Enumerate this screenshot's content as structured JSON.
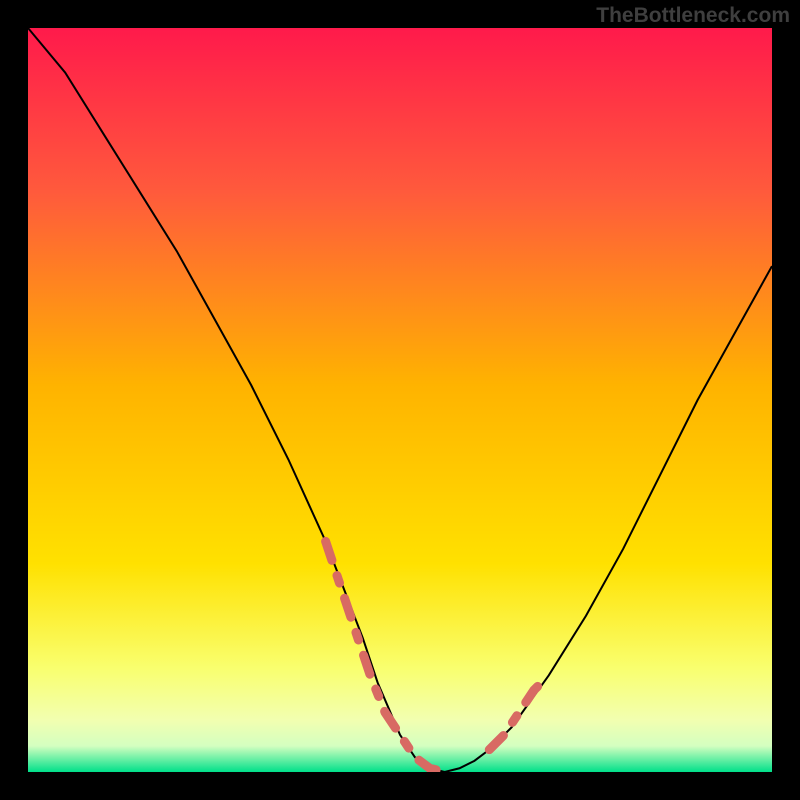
{
  "watermark": "TheBottleneck.com",
  "chart_data": {
    "type": "line",
    "title": "",
    "xlabel": "",
    "ylabel": "",
    "xlim": [
      0,
      100
    ],
    "ylim": [
      0,
      100
    ],
    "background_gradient": {
      "top": "#ff1a4b",
      "mid": "#ffd400",
      "lower": "#f7ff6b",
      "bottom_band": "#00e08a"
    },
    "series": [
      {
        "name": "main-curve",
        "stroke": "#000000",
        "x": [
          0,
          5,
          10,
          15,
          20,
          25,
          30,
          35,
          40,
          45,
          47,
          50,
          52,
          54,
          56,
          58,
          60,
          62,
          65,
          70,
          75,
          80,
          85,
          90,
          95,
          100
        ],
        "y": [
          100,
          94,
          86,
          78,
          70,
          61,
          52,
          42,
          31,
          18,
          12,
          5,
          2,
          0.5,
          0,
          0.5,
          1.5,
          3,
          6,
          13,
          21,
          30,
          40,
          50,
          59,
          68
        ]
      },
      {
        "name": "left-dash",
        "stroke": "#d86a63",
        "dash": true,
        "x": [
          40,
          42,
          44,
          46,
          48,
          50,
          52,
          54,
          56
        ],
        "y": [
          31,
          25,
          19,
          13,
          8,
          5,
          2,
          0.5,
          0
        ]
      },
      {
        "name": "right-dash",
        "stroke": "#d86a63",
        "dash": true,
        "x": [
          62,
          64,
          66,
          68,
          70
        ],
        "y": [
          3,
          5,
          8,
          11,
          13
        ]
      }
    ]
  }
}
